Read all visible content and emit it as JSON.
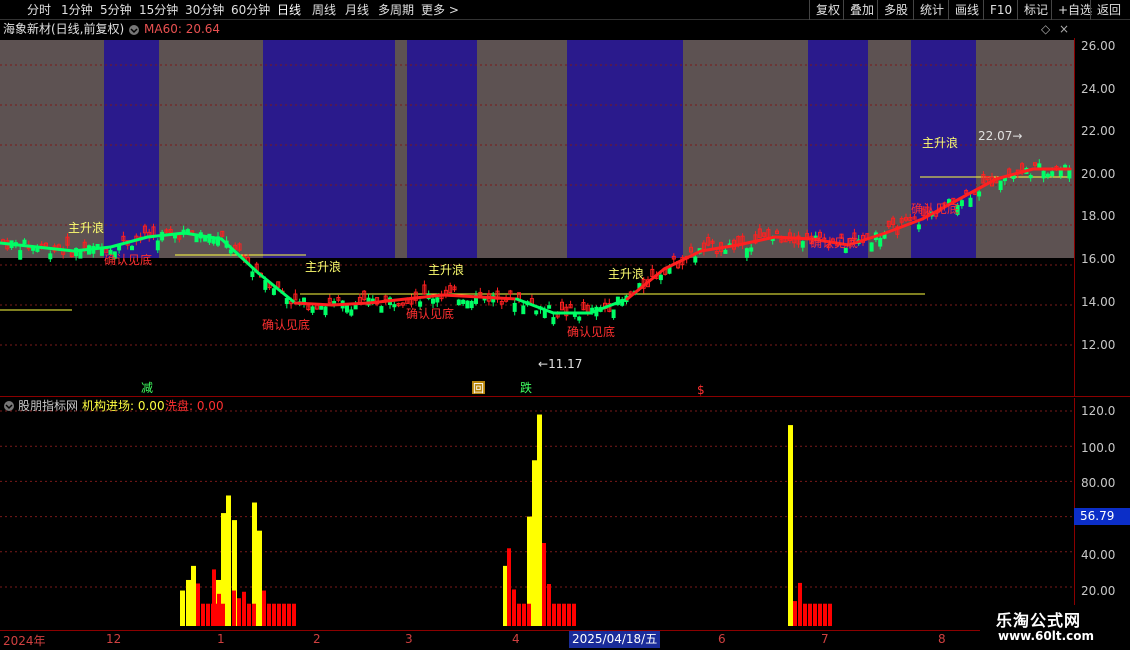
{
  "toolbar": {
    "periods": [
      "分时",
      "1分钟",
      "5分钟",
      "15分钟",
      "30分钟",
      "60分钟",
      "日线",
      "周线",
      "月线",
      "多周期"
    ],
    "active_period": "日线",
    "more": "更多 >",
    "right_buttons": [
      "复权",
      "叠加",
      "多股",
      "统计",
      "画线",
      "F10",
      "标记",
      "+自选",
      "返回"
    ]
  },
  "upper_chart": {
    "stock_title": "海象新材(日线,前复权)",
    "ma_label": "MA60: 20.64",
    "price_ticks": [
      "26.00",
      "24.00",
      "22.00",
      "20.00",
      "18.00",
      "16.00",
      "14.00",
      "12.00"
    ],
    "annotations": {
      "main_wave": "主升浪",
      "confirm_bottom": "确认见底",
      "low_price": "11.17",
      "high_price": "22.07",
      "mark_reduce": "减",
      "mark_back": "回",
      "mark_fall": "跌",
      "mark_s": "$"
    }
  },
  "indicator": {
    "title": "股朋指标网",
    "inst_label": "机构进场: 0.00",
    "wash_label": "洗盘: 0.00",
    "ticks": [
      "120.0",
      "100.0",
      "80.00",
      "60.00",
      "40.00",
      "20.00"
    ],
    "current_value": "56.79"
  },
  "date_axis": {
    "labels": [
      "2024年",
      "12",
      "1",
      "2",
      "3",
      "4",
      "6",
      "7",
      "8"
    ],
    "highlight": "2025/04/18/五"
  },
  "watermark": {
    "line1": "乐淘公式网",
    "line2": "www.60lt.com"
  },
  "colors": {
    "up": "#ff2020",
    "down": "#00ff66",
    "band_gray": "#5d5252",
    "band_blue": "#2a1a8c",
    "ind_yellow": "#ffff00",
    "ind_red": "#ff0000",
    "axis": "#8b0000"
  },
  "chart_data": [
    {
      "type": "line",
      "title": "海象新材(日线,前复权)",
      "ylim": [
        11,
        26.5
      ],
      "yticks": [
        12,
        14,
        16,
        18,
        20,
        22,
        24,
        26
      ],
      "series": [
        {
          "name": "MA60",
          "values": [
            17.1,
            16.9,
            16.7,
            16.9,
            17.4,
            17.6,
            17.3,
            15.6,
            14.1,
            14.0,
            14.1,
            14.3,
            14.5,
            14.4,
            14.3,
            13.6,
            13.6,
            14.3,
            15.8,
            16.7,
            17.0,
            17.4,
            17.3,
            17.0,
            17.6,
            18.3,
            19.3,
            20.3,
            20.8,
            20.8
          ]
        }
      ],
      "annotations": [
        {
          "text": "11.17",
          "value": 11.17
        },
        {
          "text": "22.07",
          "value": 22.07
        }
      ]
    },
    {
      "type": "bar",
      "title": "股朋指标网",
      "ylim": [
        10,
        125
      ],
      "yticks": [
        20,
        40,
        60,
        80,
        100,
        120
      ],
      "series": [
        {
          "name": "机构进场",
          "values": [
            18,
            24,
            32,
            24,
            62,
            72,
            58,
            68,
            52,
            32,
            60,
            92,
            118,
            112
          ]
        },
        {
          "name": "洗盘",
          "values": [
            22,
            16,
            12,
            36,
            20,
            42,
            30,
            26,
            18,
            22,
            45,
            35,
            24,
            18,
            14
          ]
        }
      ]
    }
  ]
}
